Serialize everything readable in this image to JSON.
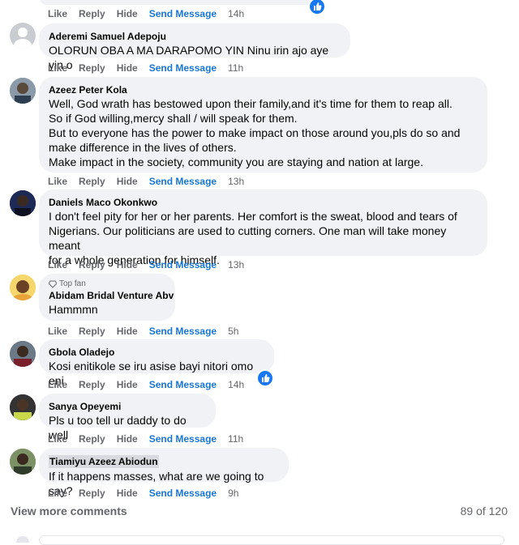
{
  "actions": {
    "like": "Like",
    "reply": "Reply",
    "hide": "Hide",
    "send": "Send Message"
  },
  "comments": [
    {
      "author": "",
      "text": "",
      "time": "14h",
      "reaction": "like"
    },
    {
      "author": "Aderemi Samuel Adepoju",
      "text": "OLORUN OBA A MA DARAPOMO YIN Ninu irin ajo aye yin o",
      "time": "11h"
    },
    {
      "author": "Azeez Peter Kola",
      "lines": [
        "Well, God wrath has bestowed upon their family,and it's time for them to reap all.",
        "So if God willing,mercy shall / will speak for them.",
        "But to everyone has the power to make impact on those around you,pls do so and",
        "make difference in the lives of others.",
        "Make impact in the society, community you are staying and nation at large."
      ],
      "time": "13h"
    },
    {
      "author": "Daniels Maco Okonkwo",
      "lines": [
        "I don't feel pity for her or her parents. Her comfort is the sweat, blood and tears of",
        "Nigerians. Our politicians are used to cutting corners. One man will take money meant",
        "for a whole generation for himself."
      ],
      "time": "13h"
    },
    {
      "badge": "Top fan",
      "author": "Abidam Bridal Venture Abv",
      "text": "Hammmn",
      "time": "5h"
    },
    {
      "author": "Gbola Oladejo",
      "text": "Kosi enitikole se iru asise bayi nitori omo eni",
      "time": "14h",
      "reaction": "like"
    },
    {
      "author": "Sanya Opeyemi",
      "text": "Pls u too tell ur daddy to do well",
      "time": "11h"
    },
    {
      "author": "Tiamiyu Azeez Abiodun",
      "text": "If it happens masses, what are we going to say?",
      "time": "9h"
    }
  ],
  "footer": {
    "view_more": "View more comments",
    "count": "89 of 120"
  },
  "colors": {
    "bubble": "#f0f2f5",
    "link": "#1876d2",
    "muted": "#65676b",
    "like": "#1877f2"
  }
}
